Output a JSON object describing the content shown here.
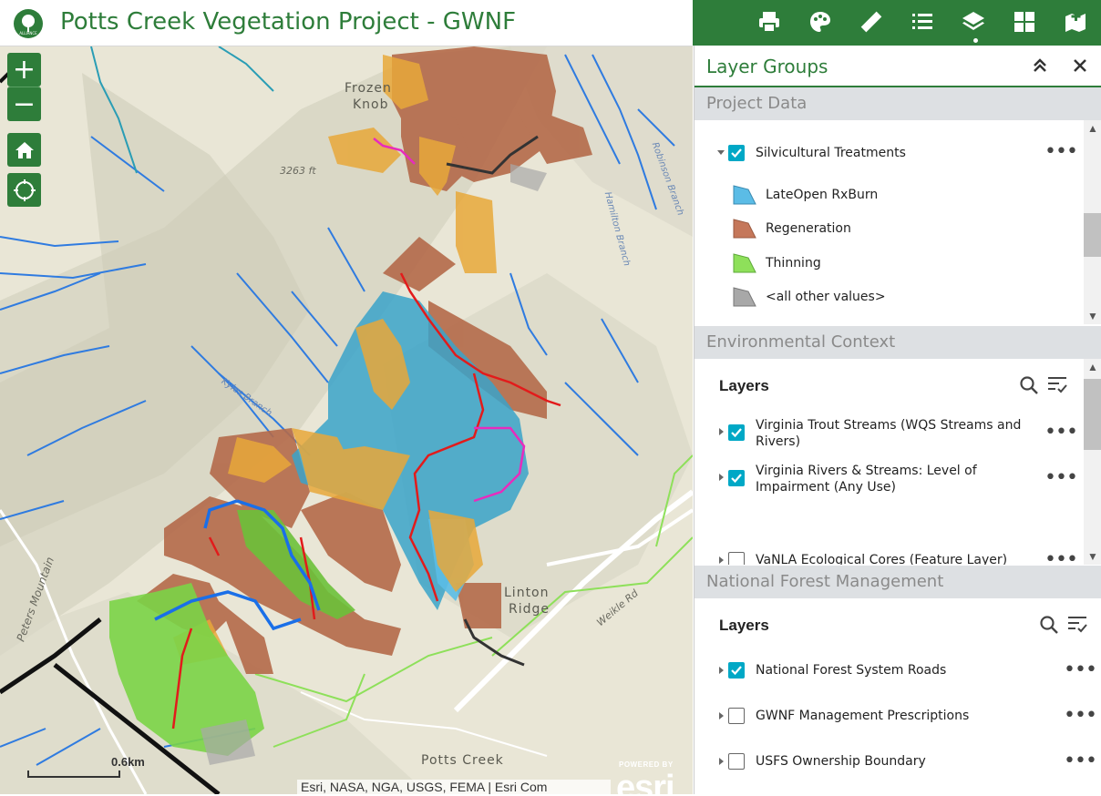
{
  "header": {
    "title": "Potts Creek Vegetation Project - GWNF",
    "logo_text": "ALLIANCE"
  },
  "toolbar": {
    "tools": [
      "print-icon",
      "palette-icon",
      "ruler-icon",
      "list-icon",
      "layers-icon",
      "grid-icon",
      "map-add-icon"
    ]
  },
  "map": {
    "zoom_in": "+",
    "zoom_out": "−",
    "labels": {
      "frozen_knob_1": "Frozen",
      "frozen_knob_2": "Knob",
      "elevation": "3263 ft",
      "linton_1": "Linton",
      "linton_2": "Ridge",
      "peters": "Peters Mountain",
      "potts_creek": "Potts Creek",
      "weikle": "Weikle Rd",
      "robinson": "Robinson Branch",
      "hamilton": "Hamilton Branch",
      "kyles": "Kyles Branch"
    },
    "scale": "0.6km",
    "attribution": "Esri, NASA, NGA, USGS, FEMA | Esri Com",
    "esri_powered": "POWERED BY",
    "esri_logo": "esri"
  },
  "panel": {
    "title": "Layer Groups",
    "groups": [
      {
        "name": "Project Data",
        "layer": {
          "label": "Silvicultural Treatments",
          "checked": true,
          "legend": [
            {
              "label": "LateOpen RxBurn",
              "color": "#5bbce6"
            },
            {
              "label": "Regeneration",
              "color": "#c5775a"
            },
            {
              "label": "Thinning",
              "color": "#8ee05a"
            },
            {
              "label": "<all other values>",
              "color": "#a8a8a8"
            }
          ]
        }
      },
      {
        "name": "Environmental Context",
        "layers_heading": "Layers",
        "layers": [
          {
            "label_1": "Virginia Trout Streams (WQS Streams and",
            "label_2": "Rivers)",
            "checked": true
          },
          {
            "label_1": "Virginia Rivers & Streams: Level of",
            "label_2": "Impairment (Any Use)",
            "checked": true
          },
          {
            "label_1": "VaNLA Ecological Cores (Feature Layer)",
            "label_2": "",
            "checked": false
          }
        ]
      },
      {
        "name": "National Forest Management",
        "layers_heading": "Layers",
        "layers": [
          {
            "label_1": "National Forest System Roads",
            "checked": true
          },
          {
            "label_1": "GWNF Management Prescriptions",
            "checked": false
          },
          {
            "label_1": "USFS Ownership Boundary",
            "checked": false
          }
        ]
      }
    ]
  }
}
